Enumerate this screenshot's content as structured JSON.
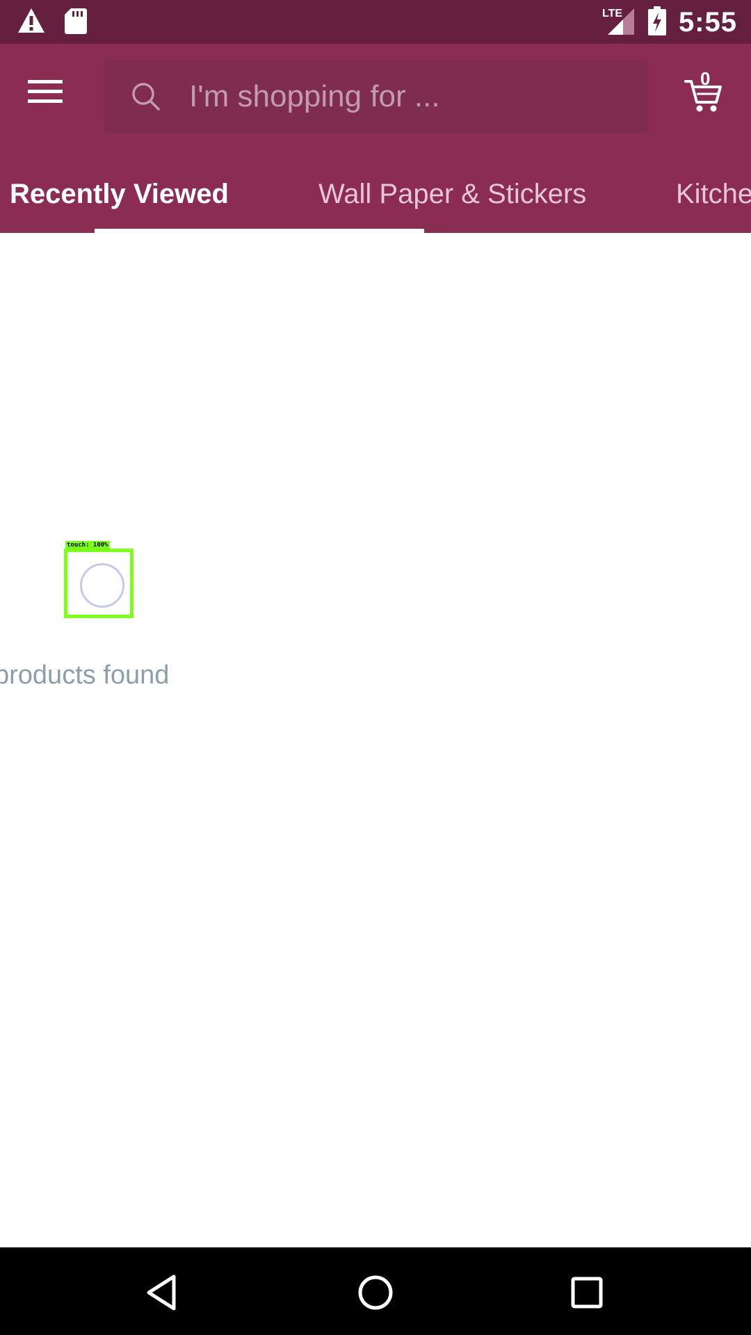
{
  "status_bar": {
    "icons": [
      "warning-icon",
      "sd-card-icon",
      "lte-signal-icon",
      "battery-charging-icon"
    ],
    "network": "LTE",
    "time": "5:55"
  },
  "app_bar": {
    "menu_icon": "hamburger-menu-icon",
    "search": {
      "placeholder": "I'm shopping for ..."
    },
    "cart": {
      "icon": "cart-icon",
      "count": "0"
    }
  },
  "tabs": [
    {
      "label": "Recently Viewed",
      "active": true
    },
    {
      "label": "Wall Paper & Stickers",
      "active": false
    },
    {
      "label": "Kitche",
      "active": false
    }
  ],
  "content": {
    "empty_message": "products found",
    "touch_overlay_label": "touch: 100%"
  },
  "nav_bar": {
    "icons": [
      "back-icon",
      "home-icon",
      "recents-icon"
    ]
  },
  "colors": {
    "status_bar": "#66203f",
    "app_bar": "#8b2c53",
    "search_box": "#7e2c4f",
    "empty_text": "#8a9fab",
    "touch_overlay": "#7cff1a"
  }
}
